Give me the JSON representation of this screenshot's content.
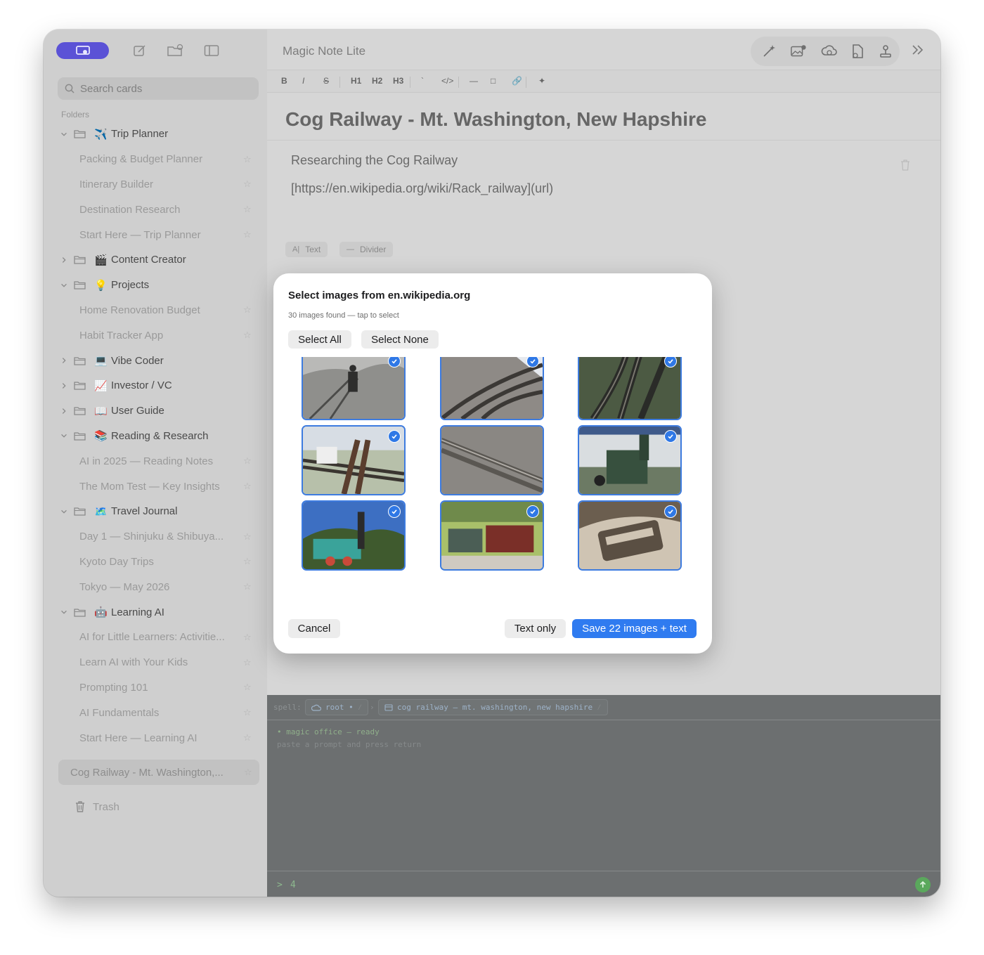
{
  "app": {
    "title": "Magic Note Lite"
  },
  "sidebar": {
    "search_placeholder": "Search cards",
    "folders_label": "Folders",
    "tree": [
      {
        "kind": "folder",
        "expanded": true,
        "emoji": "✈️",
        "label": "Trip Planner"
      },
      {
        "kind": "note",
        "label": "Packing & Budget Planner"
      },
      {
        "kind": "note",
        "label": "Itinerary Builder"
      },
      {
        "kind": "note",
        "label": "Destination Research"
      },
      {
        "kind": "note",
        "label": "Start Here — Trip Planner"
      },
      {
        "kind": "folder",
        "expanded": false,
        "emoji": "🎬",
        "label": "Content Creator"
      },
      {
        "kind": "folder",
        "expanded": true,
        "emoji": "💡",
        "label": "Projects"
      },
      {
        "kind": "note",
        "label": "Home Renovation Budget"
      },
      {
        "kind": "note",
        "label": "Habit Tracker App"
      },
      {
        "kind": "folder",
        "expanded": false,
        "emoji": "💻",
        "label": "Vibe Coder"
      },
      {
        "kind": "folder",
        "expanded": false,
        "emoji": "📈",
        "label": "Investor / VC"
      },
      {
        "kind": "folder",
        "expanded": false,
        "emoji": "📖",
        "label": "User Guide"
      },
      {
        "kind": "folder",
        "expanded": true,
        "emoji": "📚",
        "label": "Reading & Research"
      },
      {
        "kind": "note",
        "label": "AI in 2025 — Reading Notes"
      },
      {
        "kind": "note",
        "label": "The Mom Test — Key Insights"
      },
      {
        "kind": "folder",
        "expanded": true,
        "emoji": "🗺️",
        "label": "Travel Journal"
      },
      {
        "kind": "note",
        "label": "Day 1 — Shinjuku & Shibuya..."
      },
      {
        "kind": "note",
        "label": "Kyoto Day Trips"
      },
      {
        "kind": "note",
        "label": "Tokyo — May 2026"
      },
      {
        "kind": "folder",
        "expanded": true,
        "emoji": "🤖",
        "label": "Learning AI"
      },
      {
        "kind": "note",
        "label": "AI for Little Learners: Activitie..."
      },
      {
        "kind": "note",
        "label": "Learn AI with Your Kids"
      },
      {
        "kind": "note",
        "label": "Prompting 101"
      },
      {
        "kind": "note",
        "label": "AI Fundamentals"
      },
      {
        "kind": "note",
        "label": "Start Here — Learning AI"
      }
    ],
    "selected_note": "Cog Railway - Mt. Washington,...",
    "trash_label": "Trash"
  },
  "toolbar": {
    "format": [
      "B",
      "I",
      "S",
      "H1",
      "H2",
      "H3",
      "`",
      "</>",
      "—",
      "□",
      "🔗",
      "✦"
    ]
  },
  "editor": {
    "title": "Cog Railway - Mt. Washington, New Hapshire",
    "line1": "Researching the Cog Railway",
    "line2": "[https://en.wikipedia.org/wiki/Rack_railway](url)",
    "chips": [
      {
        "icon": "A|",
        "label": "Text"
      },
      {
        "icon": "—",
        "label": "Divider"
      }
    ]
  },
  "terminal": {
    "spell_label": "spell:",
    "root_label": "root •",
    "path_label": "cog railway — mt. washington, new hapshire",
    "status_line": "• magic office — ready",
    "hint_line": "paste a prompt and press return",
    "prompt": ">",
    "input_value": "4"
  },
  "modal": {
    "title": "Select images from en.wikipedia.org",
    "subtitle": "30 images found — tap to select",
    "select_all": "Select All",
    "select_none": "Select None",
    "cancel": "Cancel",
    "text_only": "Text only",
    "save": "Save 22 images + text",
    "images_found": 30,
    "images_selected": 22,
    "thumbnails": [
      {
        "scene": "old-engraving-rack",
        "selected": false
      },
      {
        "scene": "cog-wheel-closeup",
        "selected": false
      },
      {
        "scene": "rack-track-top",
        "selected": false
      },
      {
        "scene": "bw-worker-on-track",
        "selected": true
      },
      {
        "scene": "rack-switch-snow",
        "selected": true
      },
      {
        "scene": "rack-switch-dark",
        "selected": true
      },
      {
        "scene": "rack-turntable",
        "selected": true
      },
      {
        "scene": "rack-rail-gravel",
        "selected": false
      },
      {
        "scene": "green-steam-loco",
        "selected": true
      },
      {
        "scene": "mt-washington-loco",
        "selected": true
      },
      {
        "scene": "red-loco-station",
        "selected": true
      },
      {
        "scene": "sepia-railcar-tunnel",
        "selected": true
      }
    ]
  },
  "colors": {
    "accent": "#2f7bf0",
    "sidebar_pill": "#5b52d6",
    "terminal_bg": "#6c6f70",
    "terminal_green": "#8db88e"
  }
}
